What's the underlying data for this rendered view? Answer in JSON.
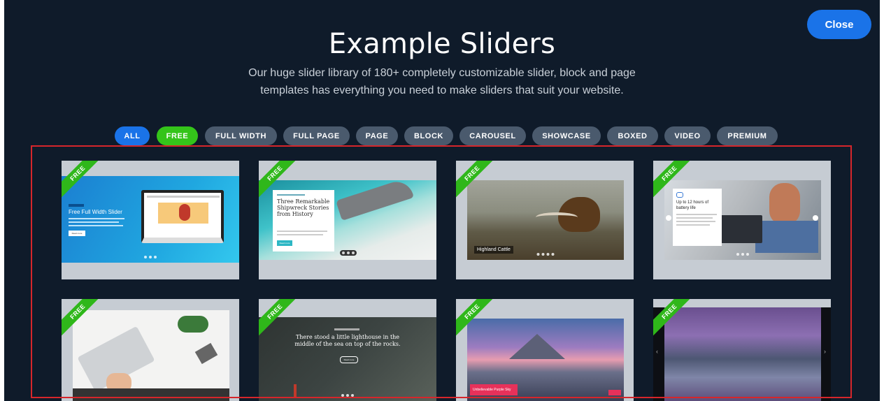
{
  "header": {
    "title": "Example Sliders",
    "subtitle_line1": "Our huge slider library of 180+ completely customizable slider, block and page",
    "subtitle_line2": "templates has everything you need to make sliders that suit your website.",
    "close_label": "Close"
  },
  "filters": [
    "ALL",
    "FREE",
    "FULL WIDTH",
    "FULL PAGE",
    "PAGE",
    "BLOCK",
    "CAROUSEL",
    "SHOWCASE",
    "BOXED",
    "VIDEO",
    "PREMIUM"
  ],
  "active_filter": "FREE",
  "badge_label": "FREE",
  "cards": [
    {
      "heading": "Free Full Width Slider",
      "button": "Read more"
    },
    {
      "heading": "Three Remarkable Shipwreck Stories from History",
      "button": "Read more"
    },
    {
      "caption": "Highland Cattle"
    },
    {
      "heading": "Up to 12 hours of battery life"
    },
    {},
    {
      "heading": "There stood a little lighthouse in the middle of the sea on top of the rocks.",
      "button": "Read more"
    },
    {
      "caption": "Unbelievable Purple Sky"
    },
    {}
  ],
  "colors": {
    "background": "#0f1b2a",
    "accent": "#1a73e8",
    "free": "#34c41a",
    "chip": "#4a5a6d",
    "highlight": "#d6262b"
  }
}
